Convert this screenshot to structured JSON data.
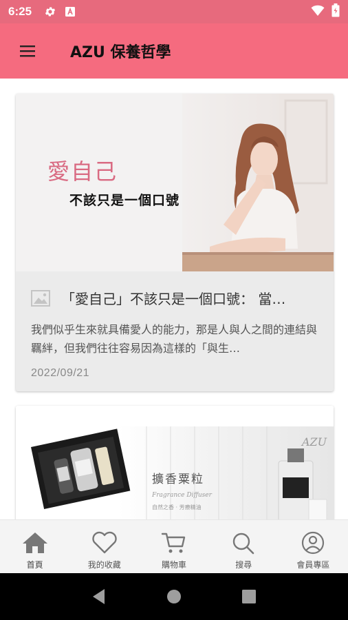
{
  "status_bar": {
    "time": "6:25",
    "icons": [
      "gear-icon",
      "a-badge-icon",
      "wifi-icon",
      "battery-icon"
    ]
  },
  "app_bar": {
    "title": "AZU 保養哲學",
    "menu_icon": "hamburger-menu-icon"
  },
  "articles": [
    {
      "hero_title": "愛自己",
      "hero_subtitle": "不該只是一個口號",
      "title": "「愛自己」不該只是一個口號： 當…",
      "excerpt": "我們似乎生來就具備愛人的能力，那是人與人之間的連結與羈絆，但我們往往容易因為這樣的「與生…",
      "date": "2022/09/21"
    },
    {
      "hero_brand": "AZU",
      "hero_title": "擴香粟粒",
      "hero_script": "Fragrance Diffuser",
      "hero_caption": "自然之香 · 芳療精油"
    }
  ],
  "bottom_nav": [
    {
      "label": "首頁",
      "icon": "home-icon",
      "active": true
    },
    {
      "label": "我的收藏",
      "icon": "heart-icon",
      "active": false
    },
    {
      "label": "購物車",
      "icon": "cart-icon",
      "active": false
    },
    {
      "label": "搜尋",
      "icon": "search-icon",
      "active": false
    },
    {
      "label": "會員專區",
      "icon": "user-icon",
      "active": false
    }
  ],
  "colors": {
    "status_bar": "#e76a7d",
    "app_bar": "#f56b7f",
    "hero_title": "#d96a82"
  }
}
